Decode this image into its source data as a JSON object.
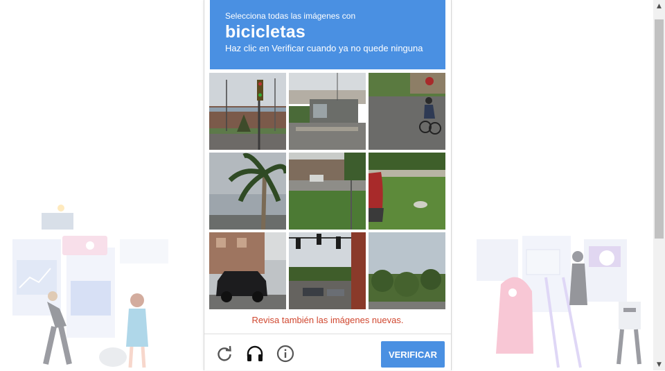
{
  "challenge": {
    "instruction_line1": "Selecciona todas las imágenes con",
    "keyword": "bicicletas",
    "instruction_line3": "Haz clic en Verificar cuando ya no quede ninguna"
  },
  "tiles": [
    {
      "content": "street-traffic-light-building"
    },
    {
      "content": "bus-stop-shelter"
    },
    {
      "content": "cyclist-on-road"
    },
    {
      "content": "palm-tree"
    },
    {
      "content": "parking-lot-grass"
    },
    {
      "content": "grass-red-car"
    },
    {
      "content": "black-suv-building"
    },
    {
      "content": "traffic-lights-intersection"
    },
    {
      "content": "trees-sky"
    }
  ],
  "notice": "Revisa también las imágenes nuevas.",
  "footer": {
    "reload_icon": "reload-icon",
    "audio_icon": "headphones-icon",
    "info_icon": "info-icon",
    "verify_label": "VERIFICAR"
  },
  "colors": {
    "header_bg": "#4a90e2",
    "verify_bg": "#4a90e2",
    "notice_text": "#d0472f"
  }
}
